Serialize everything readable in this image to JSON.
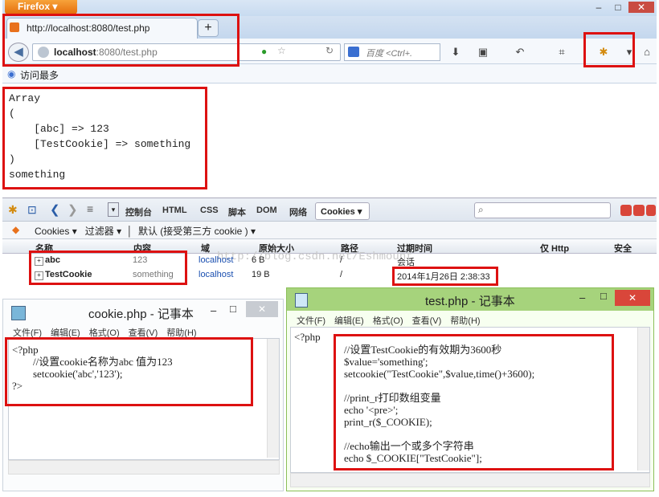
{
  "browser": {
    "app_button": "Firefox",
    "tab_title": "http://localhost:8080/test.php",
    "url_host": "localhost",
    "url_rest": ":8080/test.php",
    "search_placeholder": "百度 <Ctrl+.",
    "bookmark_item": "访问最多"
  },
  "page_output": {
    "lines": [
      "Array",
      "(",
      "    [abc] => 123",
      "    [TestCookie] => something",
      ")",
      "something"
    ]
  },
  "firebug": {
    "tabs": [
      "控制台",
      "HTML",
      "CSS",
      "脚本",
      "DOM",
      "网络"
    ],
    "active_tab": "Cookies",
    "sub_toolbar": [
      "Cookies",
      "过滤器",
      "默认 (接受第三方 cookie )"
    ],
    "columns": [
      "名称",
      "内容",
      "域",
      "原始大小",
      "路径",
      "过期时间",
      "仅 Http",
      "安全"
    ],
    "watermark": "http://blog.csdn.net/Eshmount",
    "rows": [
      {
        "name": "abc",
        "value": "123",
        "domain": "localhost",
        "size": "6 B",
        "path": "/",
        "expires": "会话"
      },
      {
        "name": "TestCookie",
        "value": "something",
        "domain": "localhost",
        "size": "19 B",
        "path": "/",
        "expires": "2014年1月26日 2:38:33"
      }
    ]
  },
  "notepad_cookie": {
    "title": "cookie.php - 记事本",
    "menu": [
      "文件(F)",
      "编辑(E)",
      "格式(O)",
      "查看(V)",
      "帮助(H)"
    ],
    "code": [
      "<?php",
      "        //设置cookie名称为abc 值为123",
      "        setcookie('abc','123');",
      "?>"
    ]
  },
  "notepad_test": {
    "title": "test.php - 记事本",
    "menu": [
      "文件(F)",
      "编辑(E)",
      "格式(O)",
      "查看(V)",
      "帮助(H)"
    ],
    "php_open": "<?php",
    "code": [
      "//设置TestCookie的有效期为3600秒",
      "$value='something';",
      "setcookie(\"TestCookie\",$value,time()+3600);",
      "",
      "//print_r打印数组变量",
      "echo '<pre>';",
      "print_r($_COOKIE);",
      "",
      "//echo输出一个或多个字符串",
      "echo $_COOKIE[\"TestCookie\"];"
    ]
  },
  "colors": {
    "highlight_box": "#dd1111",
    "firefox_orange": "#e46d0a",
    "close_red": "#d9463a"
  }
}
